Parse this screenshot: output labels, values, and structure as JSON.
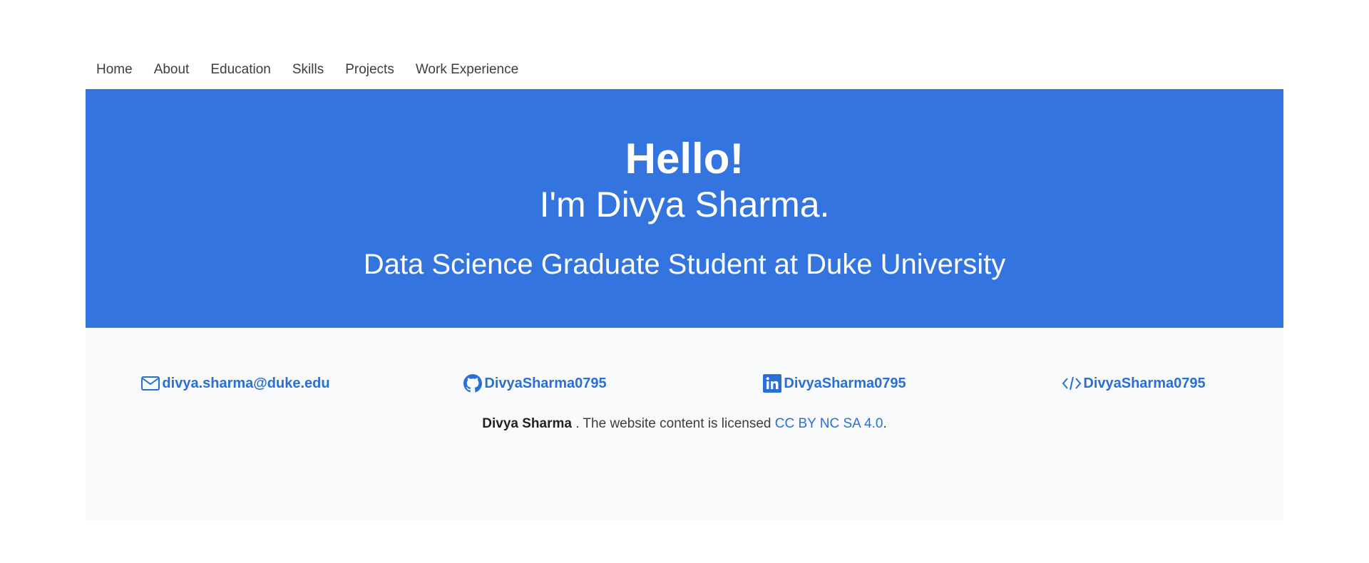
{
  "nav": {
    "items": [
      {
        "label": "Home"
      },
      {
        "label": "About"
      },
      {
        "label": "Education"
      },
      {
        "label": "Skills"
      },
      {
        "label": "Projects"
      },
      {
        "label": "Work Experience"
      }
    ]
  },
  "hero": {
    "greeting": "Hello!",
    "name_line": "I'm Divya Sharma.",
    "tagline": "Data Science Graduate Student at Duke University"
  },
  "contacts": [
    {
      "icon": "mail-icon",
      "label": "divya.sharma@duke.edu"
    },
    {
      "icon": "github-icon",
      "label": "DivyaSharma0795"
    },
    {
      "icon": "linkedin-icon",
      "label": "DivyaSharma0795"
    },
    {
      "icon": "code-icon",
      "label": "DivyaSharma0795"
    }
  ],
  "license": {
    "author": "Divya Sharma",
    "text": " . The website content is licensed ",
    "link_label": "CC BY NC SA 4.0",
    "end": "."
  },
  "colors": {
    "hero_background": "#3474de",
    "link": "#2a6fd6",
    "footer_background": "#f8f9fa"
  }
}
